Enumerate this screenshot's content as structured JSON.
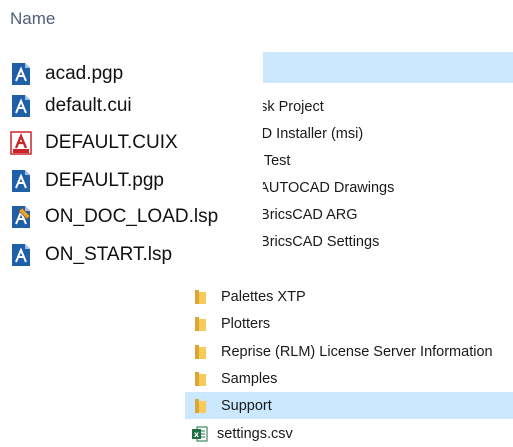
{
  "fg": {
    "column_header": "Name",
    "files": [
      {
        "name": "acad.pgp",
        "icon": "autocad-file-icon"
      },
      {
        "name": "default.cui",
        "icon": "autocad-file-icon"
      },
      {
        "name": "DEFAULT.CUIX",
        "icon": "autocad-cuix-icon"
      },
      {
        "name": "DEFAULT.pgp",
        "icon": "autocad-file-icon"
      },
      {
        "name": "ON_DOC_LOAD.lsp",
        "icon": "lisp-file-icon"
      },
      {
        "name": "ON_START.lsp",
        "icon": "autocad-file-icon"
      }
    ]
  },
  "bg": {
    "partial_items": [
      "esk Project",
      "AD Installer (msi)",
      "d Test",
      "I AUTOCAD Drawings",
      ": BricsCAD ARG",
      ": BricsCAD Settings"
    ],
    "folders": [
      {
        "name": "Palettes XTP"
      },
      {
        "name": "Plotters"
      },
      {
        "name": "Reprise (RLM) License Server Information"
      },
      {
        "name": "Samples"
      },
      {
        "name": "Support",
        "selected": true
      }
    ],
    "csv_file": {
      "name": "settings.csv",
      "icon": "excel-file-icon"
    }
  },
  "colors": {
    "selection": "#cce8ff",
    "autocad_blue": "#1f5fa8",
    "autocad_red": "#c8262c",
    "folder_yellow": "#f6cc57",
    "excel_green": "#1d7044"
  }
}
